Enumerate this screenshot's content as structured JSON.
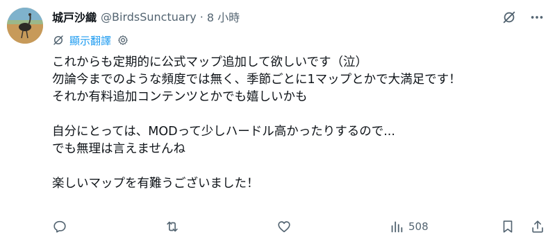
{
  "post": {
    "display_name": "城戸沙織",
    "handle": "@BirdsSunctuary",
    "separator": "·",
    "timestamp": "8 小時",
    "translate_label": "顯示翻譯",
    "text_lines": [
      "これからも定期的に公式マップ追加して欲しいです（泣）",
      "勿論今までのような頻度では無く、季節ごとに1マップとかで大満足です！",
      "それか有料追加コンテンツとかでも嬉しいかも",
      "",
      "自分にとっては、MODって少しハードル高かったりするので...",
      "でも無理は言えませんね",
      "",
      "楽しいマップを有難うございました！"
    ],
    "views_count": "508"
  },
  "icons": {
    "avatar": "avatar-ostrich-photo",
    "grok": "grok-icon",
    "more": "more-horizontal-icon",
    "translate": "translate-icon",
    "settings": "gear-icon",
    "reply": "reply-icon",
    "repost": "repost-icon",
    "like": "like-icon",
    "views": "views-icon",
    "bookmark": "bookmark-icon",
    "share": "share-icon"
  },
  "colors": {
    "text_primary": "#0f1419",
    "text_secondary": "#536471",
    "accent": "#1d9bf0",
    "background": "#ffffff"
  }
}
